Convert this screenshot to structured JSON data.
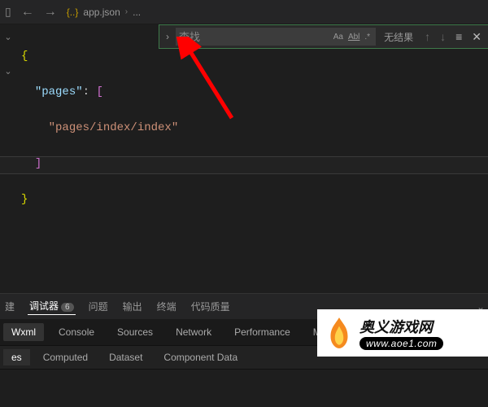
{
  "breadcrumb": {
    "filename": "app.json",
    "more": "..."
  },
  "find": {
    "placeholder": "查找",
    "value": "",
    "case_label": "Aa",
    "word_label": "Abl",
    "regex_label": ".*",
    "result_text": "无结果"
  },
  "code": {
    "brace_open": "{",
    "key_pages": "\"pages\"",
    "colon": ": ",
    "bracket_open": "[",
    "page_value": "\"pages/index/index\"",
    "bracket_close": "]",
    "brace_close": "}",
    "gutter_chevron": "⌄"
  },
  "panel": {
    "tabs1": {
      "build": "建",
      "debugger": "调试器",
      "debugger_count": "6",
      "problems": "问题",
      "output": "输出",
      "terminal": "终端",
      "quality": "代码质量"
    },
    "tabs2": {
      "wxml": "Wxml",
      "console": "Console",
      "sources": "Sources",
      "network": "Network",
      "performance": "Performance",
      "memory": "Memo"
    },
    "tabs3": {
      "es": "es",
      "computed": "Computed",
      "dataset": "Dataset",
      "component": "Component Data"
    }
  },
  "watermark": {
    "name": "奥义游戏网",
    "url": "www.aoe1.com"
  }
}
